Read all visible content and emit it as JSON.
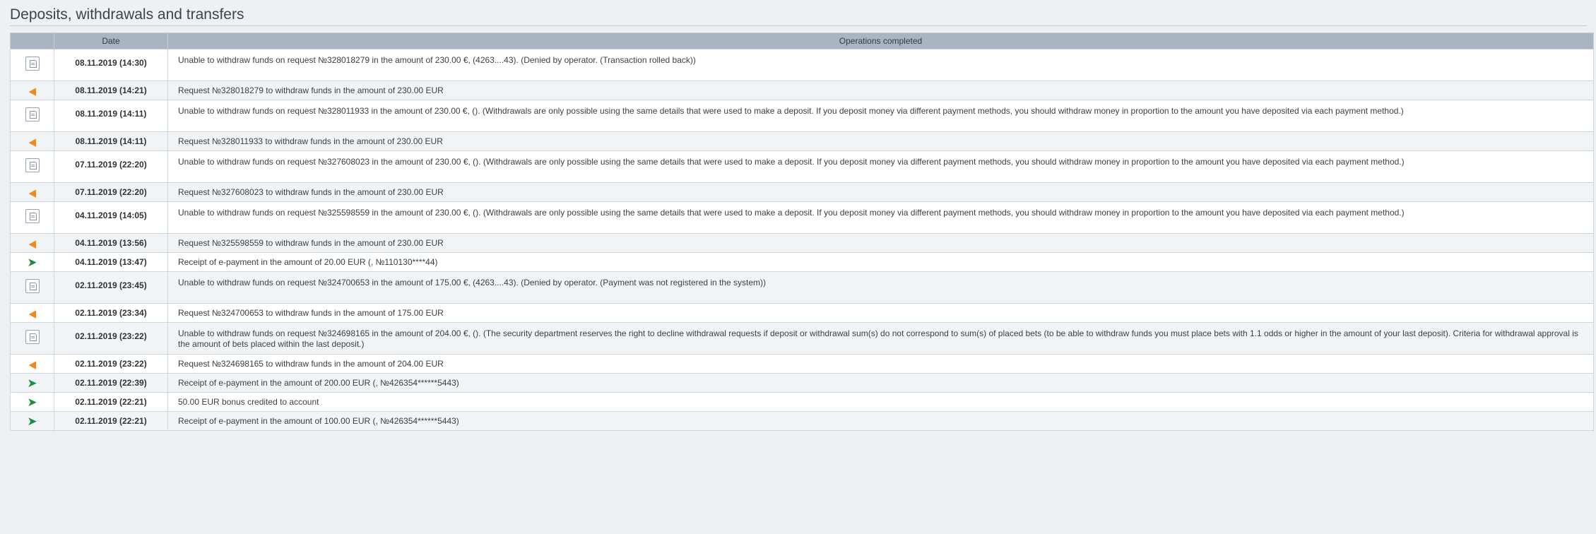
{
  "page": {
    "title": "Deposits, withdrawals and transfers"
  },
  "table": {
    "headers": {
      "icon": "",
      "date": "Date",
      "operations": "Operations completed"
    },
    "rows": [
      {
        "type": "rollback",
        "icon": "document-icon",
        "date": "08.11.2019 (14:30)",
        "text": "Unable to withdraw funds on request №328018279 in the amount of 230.00 €, (4263....43). (Denied by operator. (Transaction rolled back))",
        "tall": true
      },
      {
        "type": "withdraw",
        "icon": "arrow-left-icon",
        "date": "08.11.2019 (14:21)",
        "text": "Request №328018279 to withdraw funds in the amount of 230.00 EUR",
        "tall": false
      },
      {
        "type": "rollback",
        "icon": "document-icon",
        "date": "08.11.2019 (14:11)",
        "text": "Unable to withdraw funds on request №328011933 in the amount of 230.00 €, (). (Withdrawals are only possible using the same details that were used to make a deposit. If you deposit money via different payment methods, you should withdraw money in proportion to the amount you have deposited via each payment method.)",
        "tall": true
      },
      {
        "type": "withdraw",
        "icon": "arrow-left-icon",
        "date": "08.11.2019 (14:11)",
        "text": "Request №328011933 to withdraw funds in the amount of 230.00 EUR",
        "tall": false
      },
      {
        "type": "rollback",
        "icon": "document-icon",
        "date": "07.11.2019 (22:20)",
        "text": "Unable to withdraw funds on request №327608023 in the amount of 230.00 €, (). (Withdrawals are only possible using the same details that were used to make a deposit. If you deposit money via different payment methods, you should withdraw money in proportion to the amount you have deposited via each payment method.)",
        "tall": true
      },
      {
        "type": "withdraw",
        "icon": "arrow-left-icon",
        "date": "07.11.2019 (22:20)",
        "text": "Request №327608023 to withdraw funds in the amount of 230.00 EUR",
        "tall": false
      },
      {
        "type": "rollback",
        "icon": "document-icon",
        "date": "04.11.2019 (14:05)",
        "text": "Unable to withdraw funds on request №325598559 in the amount of 230.00 €, (). (Withdrawals are only possible using the same details that were used to make a deposit. If you deposit money via different payment methods, you should withdraw money in proportion to the amount you have deposited via each payment method.)",
        "tall": true
      },
      {
        "type": "withdraw",
        "icon": "arrow-left-icon",
        "date": "04.11.2019 (13:56)",
        "text": "Request №325598559 to withdraw funds in the amount of 230.00 EUR",
        "tall": false
      },
      {
        "type": "deposit",
        "icon": "arrow-right-icon",
        "date": "04.11.2019 (13:47)",
        "text": "Receipt of e-payment in the amount of 20.00 EUR (, №110130****44)",
        "tall": false
      },
      {
        "type": "rollback",
        "icon": "document-icon",
        "date": "02.11.2019 (23:45)",
        "text": "Unable to withdraw funds on request №324700653 in the amount of 175.00 €, (4263....43). (Denied by operator. (Payment was not registered in the system))",
        "tall": true
      },
      {
        "type": "withdraw",
        "icon": "arrow-left-icon",
        "date": "02.11.2019 (23:34)",
        "text": "Request №324700653 to withdraw funds in the amount of 175.00 EUR",
        "tall": false
      },
      {
        "type": "rollback",
        "icon": "document-icon",
        "date": "02.11.2019 (23:22)",
        "text": "Unable to withdraw funds on request №324698165 in the amount of 204.00 €, (). (The security department reserves the right to decline withdrawal requests if deposit or withdrawal sum(s) do not correspond to sum(s) of placed bets (to be able to withdraw funds you must place bets with 1.1 odds or higher in the amount of your last deposit). Criteria for withdrawal approval is the amount of bets placed within the last deposit.)",
        "tall": true
      },
      {
        "type": "withdraw",
        "icon": "arrow-left-icon",
        "date": "02.11.2019 (23:22)",
        "text": "Request №324698165 to withdraw funds in the amount of 204.00 EUR",
        "tall": false
      },
      {
        "type": "deposit",
        "icon": "arrow-right-icon",
        "date": "02.11.2019 (22:39)",
        "text": "Receipt of e-payment in the amount of 200.00 EUR (, №426354******5443)",
        "tall": false
      },
      {
        "type": "deposit",
        "icon": "arrow-right-icon",
        "date": "02.11.2019 (22:21)",
        "text": "50.00 EUR bonus credited to account",
        "tall": false
      },
      {
        "type": "deposit",
        "icon": "arrow-right-icon",
        "date": "02.11.2019 (22:21)",
        "text": "Receipt of e-payment in the amount of 100.00 EUR (, №426354******5443)",
        "tall": false
      }
    ]
  },
  "colors": {
    "withdraw_arrow": "#ef8a1a",
    "deposit_arrow": "#1e8e3e",
    "header_bg": "#a9b6c1"
  }
}
